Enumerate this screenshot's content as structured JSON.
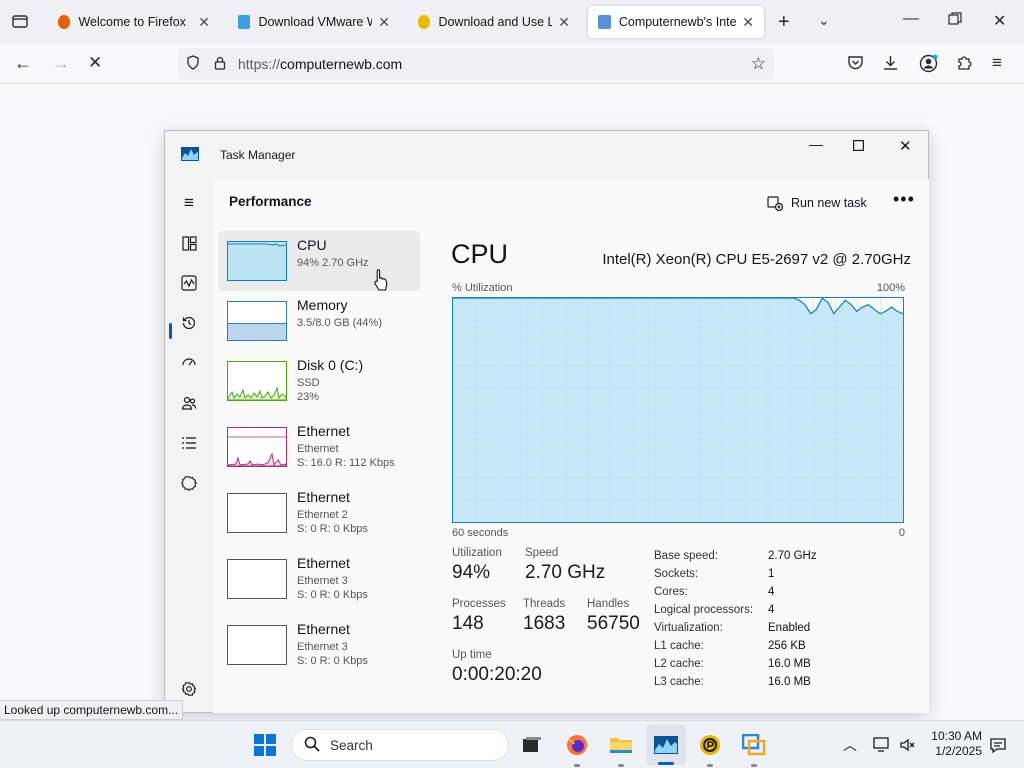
{
  "browser": {
    "tabs": [
      {
        "title": "Welcome to Firefox",
        "favicon_color": "#e66000"
      },
      {
        "title": "Download VMware Wo",
        "favicon_color": "#3c9ee5"
      },
      {
        "title": "Download and Use LDP",
        "favicon_color": "#e6b800"
      },
      {
        "title": "Computernewb's Interi",
        "favicon_color": "#5a8fd8"
      }
    ],
    "url_protocol": "https://",
    "url_host": "computernewb.com",
    "status_text": "Looked up computernewb.com..."
  },
  "task_manager": {
    "window_title": "Task Manager",
    "page_title": "Performance",
    "run_new_task": "Run new task",
    "more": "•••",
    "perf_items": [
      {
        "name": "CPU",
        "line2": "94%  2.70 GHz",
        "line3": "",
        "color": "#117dbb",
        "fill": "#bde4f4"
      },
      {
        "name": "Memory",
        "line2": "3.5/8.0 GB (44%)",
        "line3": "",
        "color": "#2f7ec0",
        "fill": "#bcd6ef"
      },
      {
        "name": "Disk 0 (C:)",
        "line2": "SSD",
        "line3": "23%",
        "color": "#4da60c",
        "fill": "#e6f2d6"
      },
      {
        "name": "Ethernet",
        "line2": "Ethernet",
        "line3": "S: 16.0  R: 112 Kbps",
        "color": "#a8326e",
        "fill": "#f6e2ec"
      },
      {
        "name": "Ethernet",
        "line2": "Ethernet 2",
        "line3": "S: 0  R: 0 Kbps",
        "color": "#555555",
        "fill": "#ffffff"
      },
      {
        "name": "Ethernet",
        "line2": "Ethernet 3",
        "line3": "S: 0  R: 0 Kbps",
        "color": "#555555",
        "fill": "#ffffff"
      },
      {
        "name": "Ethernet",
        "line2": "Ethernet 3",
        "line3": "S: 0  R: 0 Kbps",
        "color": "#555555",
        "fill": "#ffffff"
      }
    ],
    "detail": {
      "heading": "CPU",
      "model": "Intel(R) Xeon(R) CPU E5-2697 v2 @ 2.70GHz",
      "graph_label": "% Utilization",
      "graph_max": "100%",
      "graph_left": "60 seconds",
      "graph_right": "0",
      "graph_color": "#117dbb",
      "graph_fill": "#bde4f4",
      "utilization_history": [
        100,
        100,
        100,
        100,
        100,
        100,
        100,
        100,
        100,
        100,
        100,
        100,
        100,
        100,
        100,
        100,
        100,
        100,
        100,
        100,
        100,
        100,
        100,
        100,
        100,
        100,
        100,
        100,
        100,
        100,
        100,
        100,
        100,
        100,
        100,
        100,
        100,
        100,
        100,
        100,
        100,
        100,
        100,
        100,
        100,
        100,
        100,
        100,
        100,
        100,
        100,
        100,
        100,
        100,
        100,
        100,
        100,
        100,
        100,
        100,
        99,
        97,
        93,
        95,
        100,
        98,
        93,
        96,
        99,
        97,
        94,
        96,
        97,
        95,
        93,
        94,
        96,
        94,
        93
      ],
      "stats": {
        "utilization_label": "Utilization",
        "utilization": "94%",
        "speed_label": "Speed",
        "speed": "2.70 GHz",
        "processes_label": "Processes",
        "processes": "148",
        "threads_label": "Threads",
        "threads": "1683",
        "handles_label": "Handles",
        "handles": "56750",
        "uptime_label": "Up time",
        "uptime": "0:00:20:20"
      },
      "specs": [
        {
          "k": "Base speed:",
          "v": "2.70 GHz"
        },
        {
          "k": "Sockets:",
          "v": "1"
        },
        {
          "k": "Cores:",
          "v": "4"
        },
        {
          "k": "Logical processors:",
          "v": "4"
        },
        {
          "k": "Virtualization:",
          "v": "Enabled"
        },
        {
          "k": "L1 cache:",
          "v": "256 KB"
        },
        {
          "k": "L2 cache:",
          "v": "16.0 MB"
        },
        {
          "k": "L3 cache:",
          "v": "16.0 MB"
        }
      ]
    }
  },
  "taskbar": {
    "search_placeholder": "Search",
    "time": "10:30 AM",
    "date": "1/2/2025"
  }
}
